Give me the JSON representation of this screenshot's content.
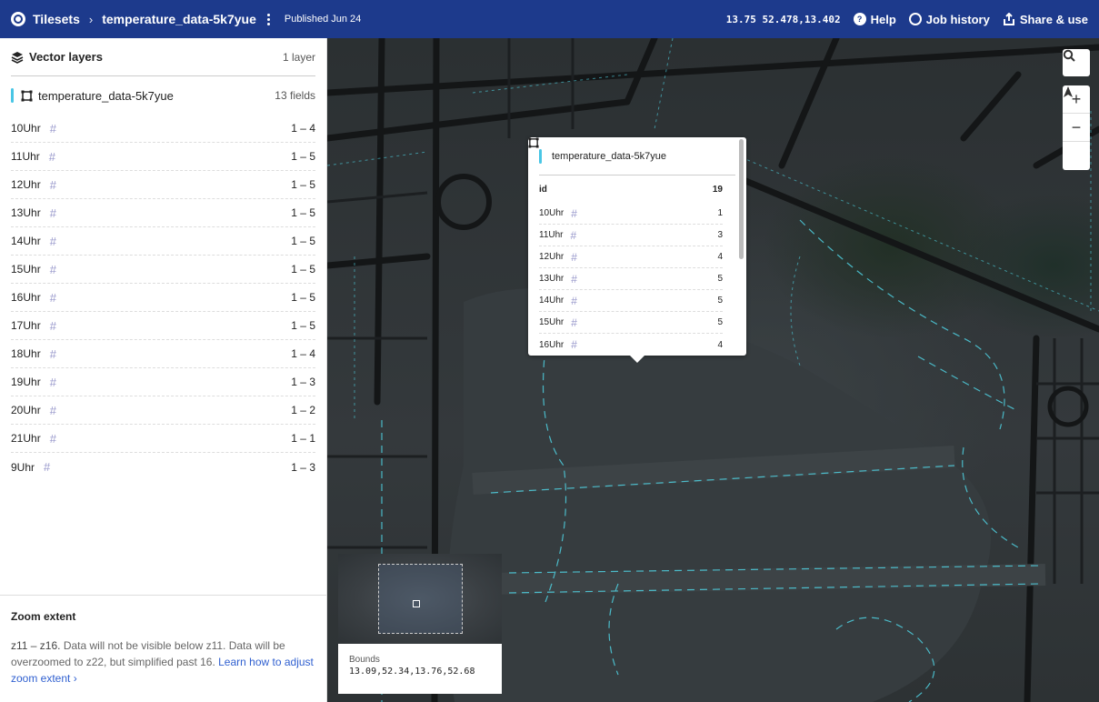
{
  "topbar": {
    "tilesets": "Tilesets",
    "tileset_name": "temperature_data-5k7yue",
    "published": "Published Jun 24",
    "coords": "13.75 52.478,13.402",
    "help": "Help",
    "job_history": "Job history",
    "share": "Share & use"
  },
  "panel": {
    "title": "Vector layers",
    "layer_count": "1 layer",
    "layer": {
      "name": "temperature_data-5k7yue",
      "fields": "13 fields"
    },
    "fields": [
      {
        "name": "10Uhr",
        "range": "1 – 4"
      },
      {
        "name": "11Uhr",
        "range": "1 – 5"
      },
      {
        "name": "12Uhr",
        "range": "1 – 5"
      },
      {
        "name": "13Uhr",
        "range": "1 – 5"
      },
      {
        "name": "14Uhr",
        "range": "1 – 5"
      },
      {
        "name": "15Uhr",
        "range": "1 – 5"
      },
      {
        "name": "16Uhr",
        "range": "1 – 5"
      },
      {
        "name": "17Uhr",
        "range": "1 – 5"
      },
      {
        "name": "18Uhr",
        "range": "1 – 4"
      },
      {
        "name": "19Uhr",
        "range": "1 – 3"
      },
      {
        "name": "20Uhr",
        "range": "1 – 2"
      },
      {
        "name": "21Uhr",
        "range": "1 – 1"
      },
      {
        "name": "9Uhr",
        "range": "1 – 3"
      }
    ],
    "zoom": {
      "title": "Zoom extent",
      "range": "z11 – z16.",
      "desc": " Data will not be visible below z11. Data will be overzoomed to z22, but simplified past 16. ",
      "link": "Learn how to adjust zoom extent"
    }
  },
  "popup": {
    "layer": "temperature_data-5k7yue",
    "id_label": "id",
    "id_value": "19",
    "rows": [
      {
        "name": "10Uhr",
        "value": "1"
      },
      {
        "name": "11Uhr",
        "value": "3"
      },
      {
        "name": "12Uhr",
        "value": "4"
      },
      {
        "name": "13Uhr",
        "value": "5"
      },
      {
        "name": "14Uhr",
        "value": "5"
      },
      {
        "name": "15Uhr",
        "value": "5"
      },
      {
        "name": "16Uhr",
        "value": "4"
      }
    ]
  },
  "map_controls": {
    "search": "search-icon",
    "zoom_in": "+",
    "zoom_out": "−",
    "compass": "compass-icon"
  },
  "minimap": {
    "bounds_label": "Bounds",
    "bounds_value": "13.09,52.34,13.76,52.68"
  }
}
